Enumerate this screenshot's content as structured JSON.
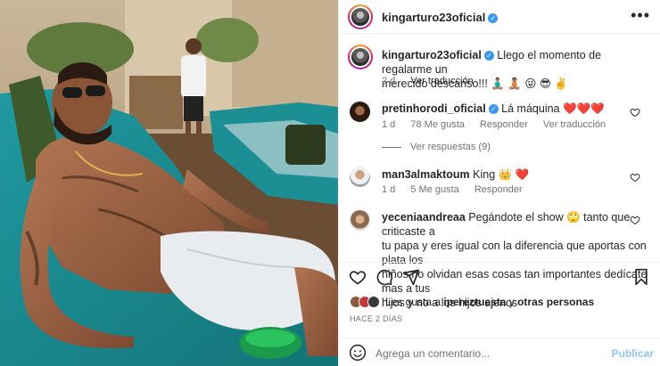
{
  "post": {
    "author": "kingarturo23oficial",
    "caption_author": "kingarturo23oficial",
    "caption_line1": "Llego el momento de regalarme un",
    "caption_line2": "merecido descanso!!! 🧘🏽‍♂️ 🧘🏽 😜 😎 ✌️",
    "caption_time": "2 d",
    "see_translation": "Ver traducción",
    "photo_alt": "man-relaxing-on-lounger"
  },
  "comments": [
    {
      "user": "pretinhorodi_oficial",
      "verified": true,
      "text": "Lá máquina ❤️❤️❤️",
      "time": "1 d",
      "likes": "78 Me gusta",
      "reply": "Responder",
      "translate": "Ver traducción",
      "view_replies": "Ver respuestas (9)"
    },
    {
      "user": "man3almaktoum",
      "verified": false,
      "text": "King 👑 ❤️",
      "time": "1 d",
      "likes": "5 Me gusta",
      "reply": "Responder"
    },
    {
      "user": "yeceniaandreaa",
      "verified": false,
      "text_l1": "Pegándote el show 🙄 tanto que criticaste a",
      "text_l2": "tu papa y eres igual con la diferencia que aportas con plata los",
      "text_l3": "niños no olvidan esas cosas tan importantes dedícate mas a tus",
      "text_l4": "hijos y no a los hijos ajenos"
    }
  ],
  "likes": {
    "prefix": "Les gusta a ",
    "user": "ipereztuesta",
    "middle": " y ",
    "others": "otras personas"
  },
  "date": "HACE 2 DÍAS",
  "comment_box": {
    "placeholder": "Agrega un comentario...",
    "publish": "Publicar"
  },
  "colors": {
    "accent": "#0095f6",
    "heart_red": "#ed4956",
    "verified_blue": "#3897f0",
    "muted": "#737373"
  }
}
